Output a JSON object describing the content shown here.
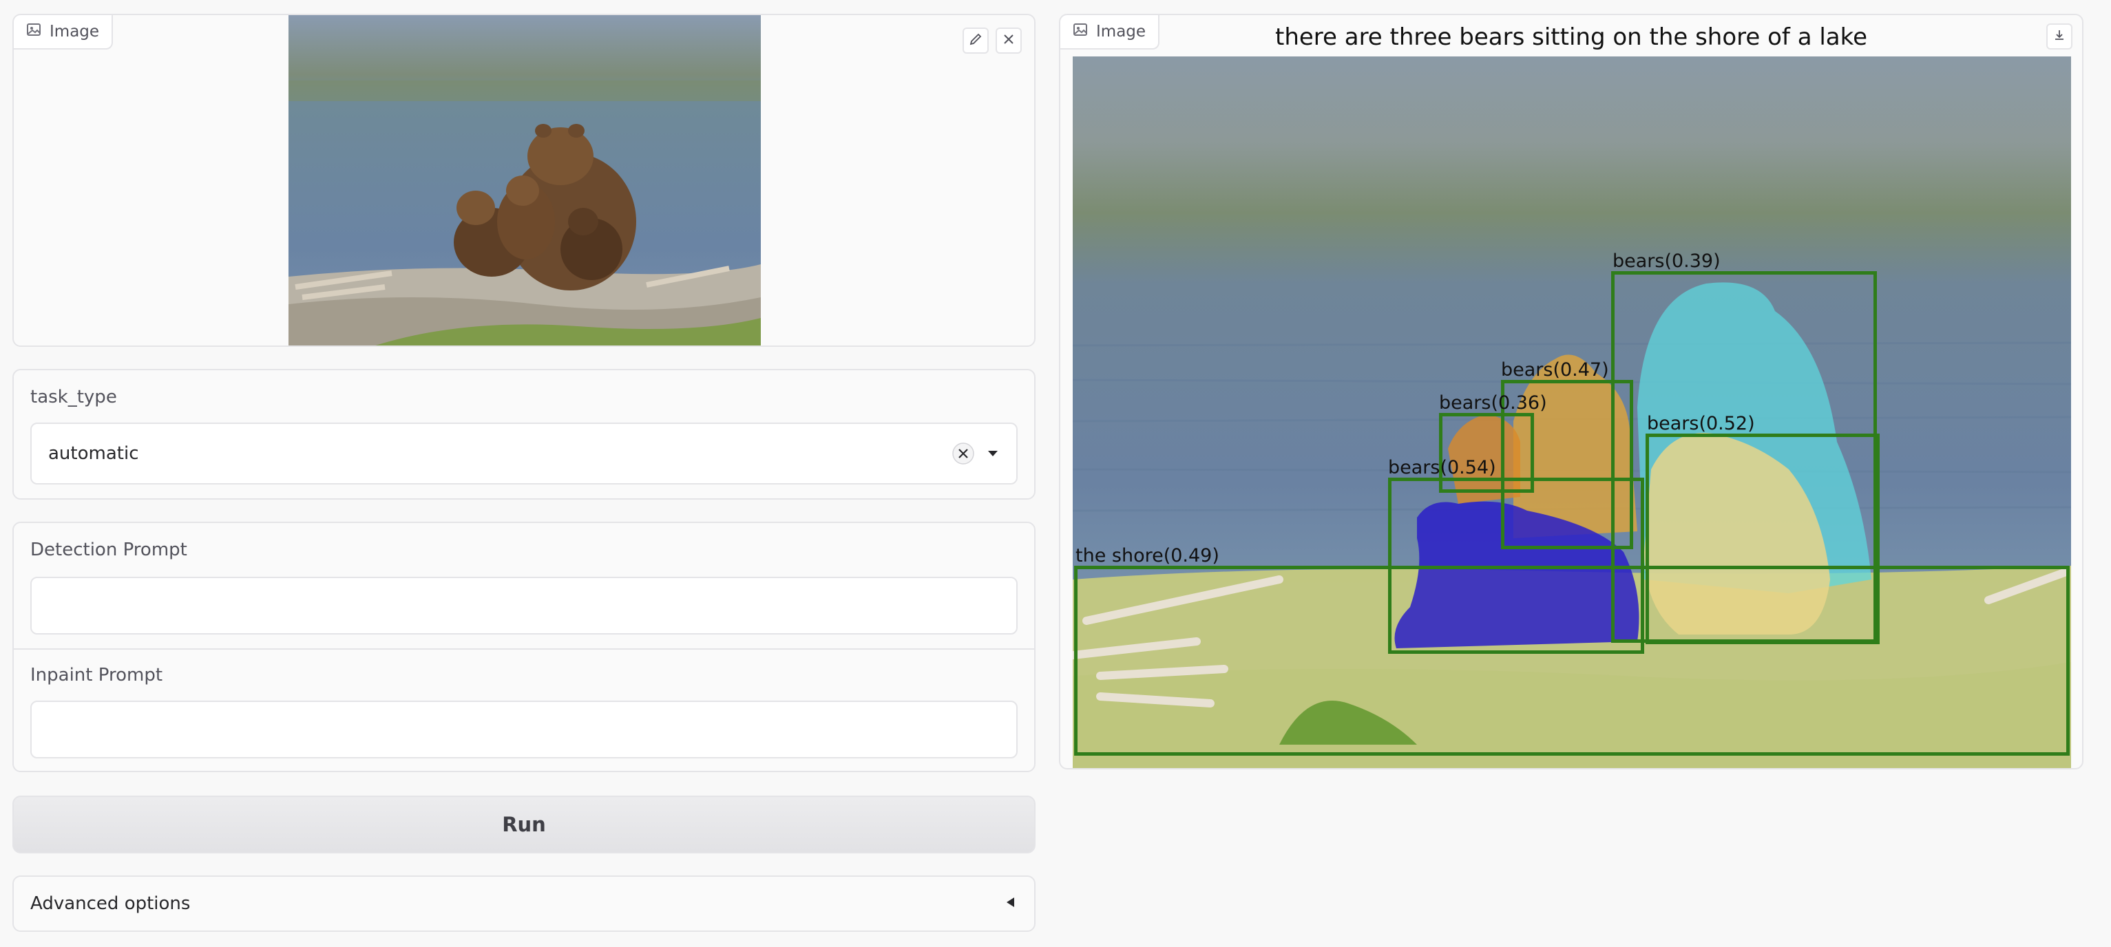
{
  "input_image": {
    "label": "Image",
    "icon": "image-icon",
    "edit_icon": "pencil-icon",
    "clear_icon": "close-icon"
  },
  "task_type": {
    "label": "task_type",
    "value": "automatic",
    "clear_icon": "circle-x-icon",
    "dropdown_icon": "caret-down-icon"
  },
  "detection_prompt": {
    "label": "Detection Prompt",
    "value": "",
    "placeholder": ""
  },
  "inpaint_prompt": {
    "label": "Inpaint Prompt",
    "value": "",
    "placeholder": ""
  },
  "run_button": {
    "label": "Run"
  },
  "advanced_options": {
    "label": "Advanced options",
    "toggle_icon": "caret-left-icon"
  },
  "output_image": {
    "label": "Image",
    "icon": "image-icon",
    "download_icon": "download-icon",
    "caption": "there are three bears sitting on the shore of a lake",
    "detections": [
      {
        "label": "bears(0.39)"
      },
      {
        "label": "bears(0.47)"
      },
      {
        "label": "bears(0.36)"
      },
      {
        "label": "bears(0.52)"
      },
      {
        "label": "bears(0.54)"
      },
      {
        "label": "the shore(0.49)"
      }
    ]
  },
  "colors": {
    "box_green": "#2f7d1a",
    "mask_cyan": "#5fd6dc",
    "mask_gold": "#e0a53a",
    "mask_orange": "#d98a2a",
    "mask_khaki": "#e7d58a",
    "mask_blue": "#2a1fc7",
    "mask_shore": "#cfd17a"
  }
}
